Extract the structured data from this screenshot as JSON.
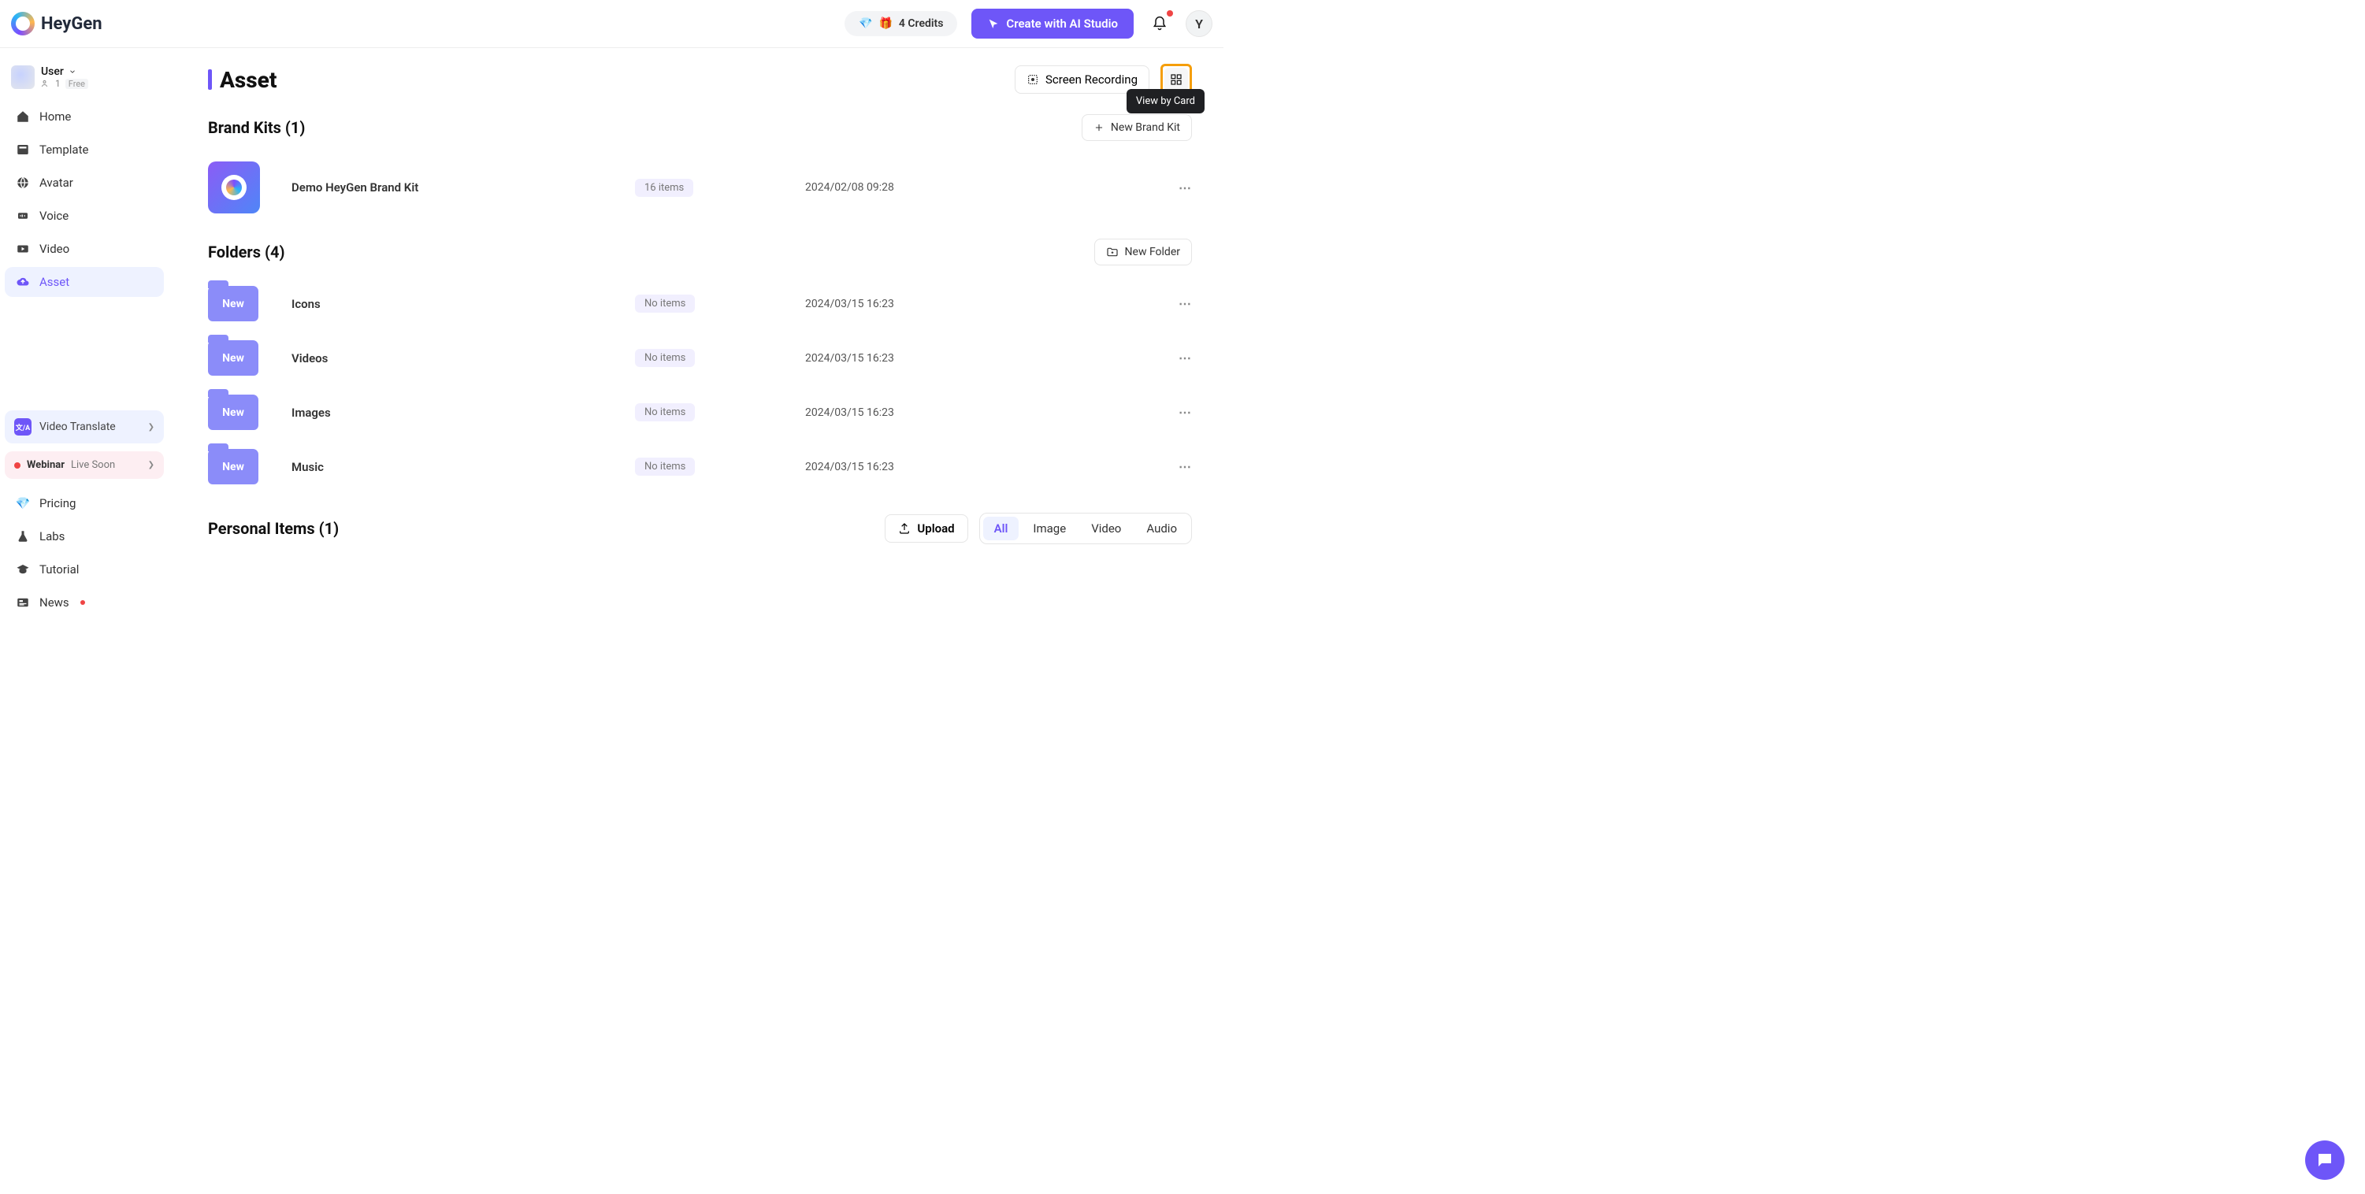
{
  "header": {
    "logo_text": "HeyGen",
    "credits_icon1": "💎",
    "credits_icon2": "🎁",
    "credits_label": "4 Credits",
    "create_label": "Create with AI Studio",
    "avatar_letter": "Y"
  },
  "workspace": {
    "name": "User",
    "members": "1",
    "plan": "Free"
  },
  "sidebar": {
    "home": "Home",
    "template": "Template",
    "avatar": "Avatar",
    "voice": "Voice",
    "video": "Video",
    "asset": "Asset",
    "video_translate": "Video Translate",
    "webinar_bold": "Webinar",
    "webinar_light": "Live Soon",
    "pricing": "Pricing",
    "labs": "Labs",
    "tutorial": "Tutorial",
    "news": "News"
  },
  "main": {
    "page_title": "Asset",
    "screen_recording": "Screen Recording",
    "tooltip": "View by Card",
    "brand_kits_title": "Brand Kits (1)",
    "new_brand_kit": "New Brand Kit",
    "brand_kit_row": {
      "name": "Demo HeyGen Brand Kit",
      "pill": "16 items",
      "date": "2024/02/08 09:28"
    },
    "folders_title": "Folders (4)",
    "new_folder": "New Folder",
    "folder_badge": "New",
    "folders": [
      {
        "name": "Icons",
        "pill": "No items",
        "date": "2024/03/15 16:23"
      },
      {
        "name": "Videos",
        "pill": "No items",
        "date": "2024/03/15 16:23"
      },
      {
        "name": "Images",
        "pill": "No items",
        "date": "2024/03/15 16:23"
      },
      {
        "name": "Music",
        "pill": "No items",
        "date": "2024/03/15 16:23"
      }
    ],
    "personal_title": "Personal Items (1)",
    "upload_label": "Upload",
    "filter_tabs": {
      "all": "All",
      "image": "Image",
      "video": "Video",
      "audio": "Audio"
    }
  }
}
